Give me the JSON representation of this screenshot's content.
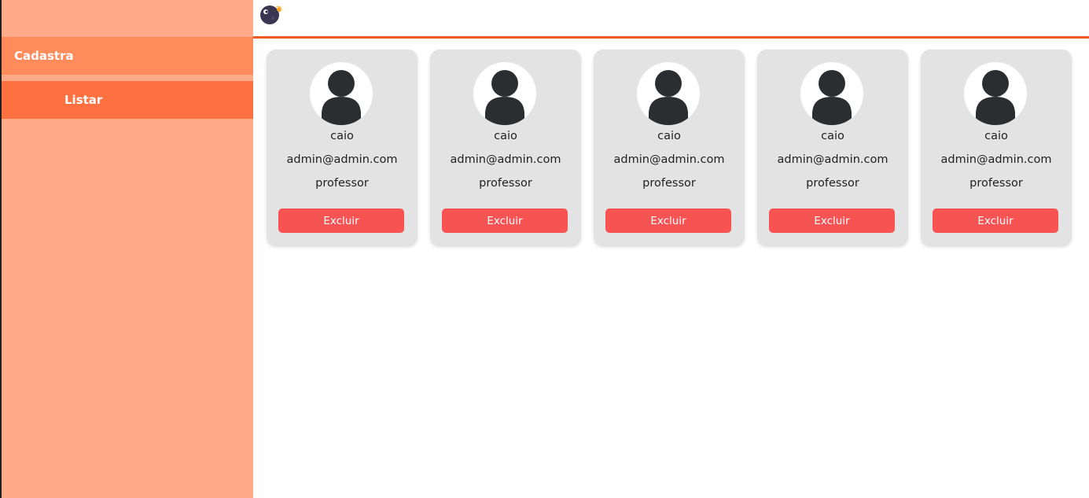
{
  "sidebar": {
    "items": [
      {
        "label": "Cadastra"
      },
      {
        "label": "Listar"
      }
    ]
  },
  "header": {
    "logo_icon": "moon-planet-logo-icon",
    "accent_color": "#f05a22"
  },
  "users": [
    {
      "name": "caio",
      "email": "admin@admin.com",
      "role": "professor",
      "delete_label": "Excluir"
    },
    {
      "name": "caio",
      "email": "admin@admin.com",
      "role": "professor",
      "delete_label": "Excluir"
    },
    {
      "name": "caio",
      "email": "admin@admin.com",
      "role": "professor",
      "delete_label": "Excluir"
    },
    {
      "name": "caio",
      "email": "admin@admin.com",
      "role": "professor",
      "delete_label": "Excluir"
    },
    {
      "name": "caio",
      "email": "admin@admin.com",
      "role": "professor",
      "delete_label": "Excluir"
    }
  ],
  "colors": {
    "sidebar_bg": "#ffaa88",
    "sidebar_active": "#ff7040",
    "delete_button": "#f75353",
    "card_bg": "#e3e3e3"
  }
}
